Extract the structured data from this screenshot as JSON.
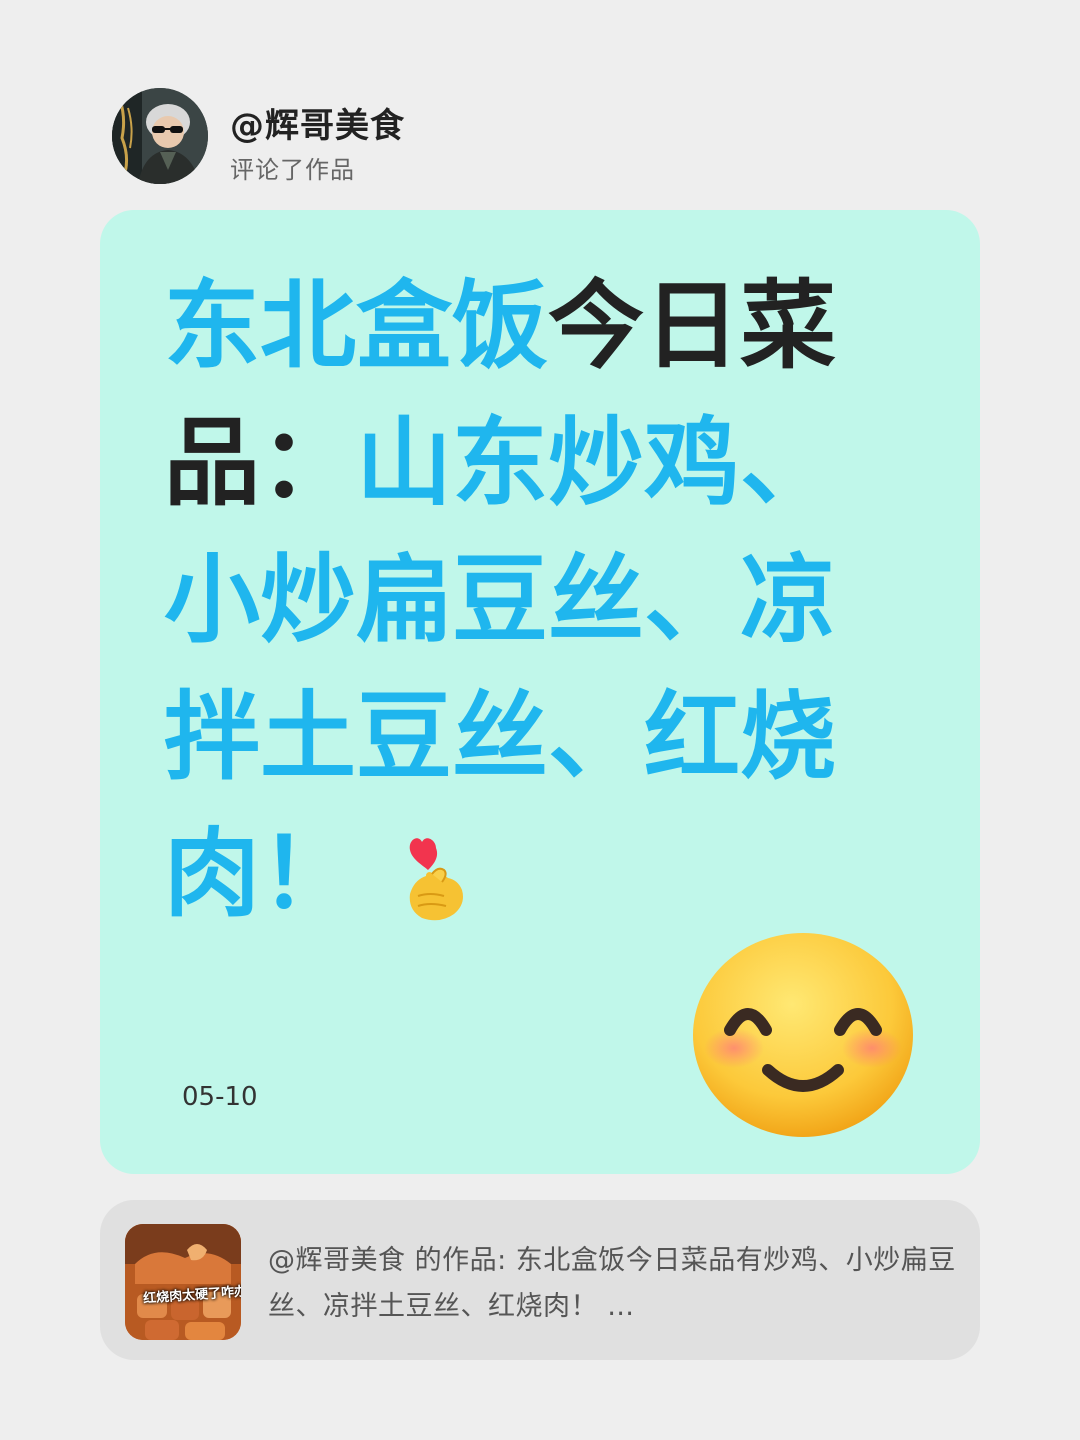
{
  "header": {
    "username": "@辉哥美食",
    "action": "评论了作品",
    "avatar_icon": "user-avatar"
  },
  "comment": {
    "text_part1": "东北盒饭",
    "text_part2": "今日菜品：",
    "text_part3": "山东炒鸡、小炒扁豆丝、凉拌土豆丝、红烧肉！",
    "emoji": "finger-heart-icon",
    "date": "05-10",
    "sticker": "smiling-face-icon",
    "colors": {
      "highlight": "#1fb6ee",
      "dark": "#222222",
      "card_bg": "#c0f7ea"
    }
  },
  "source": {
    "thumb_caption": "红烧肉太硬了咋办",
    "text": "@辉哥美食 的作品: 东北盒饭今日菜品有炒鸡、小炒扁豆丝、凉拌土豆丝、红烧肉！ …"
  }
}
